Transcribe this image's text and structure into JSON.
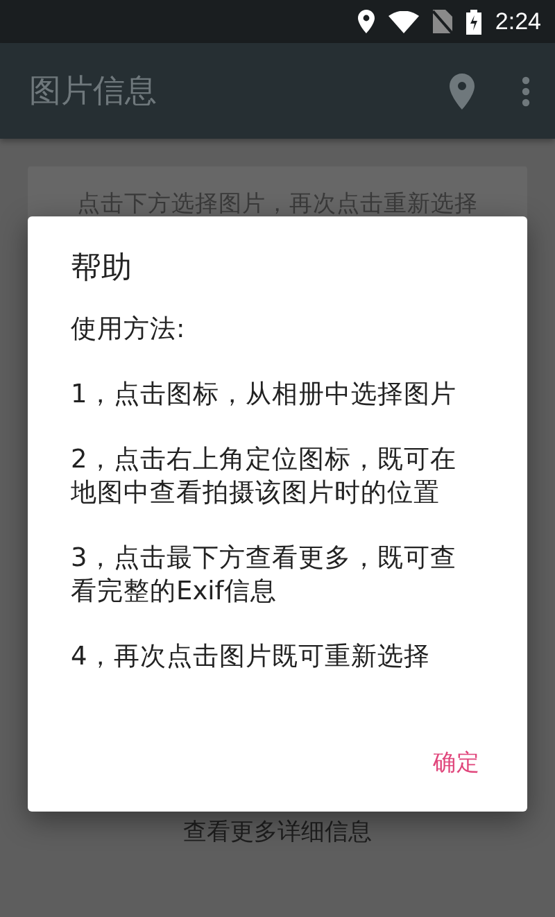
{
  "status_bar": {
    "time": "2:24"
  },
  "app_bar": {
    "title": "图片信息"
  },
  "card": {
    "hint": "点击下方选择图片，再次点击重新选择"
  },
  "footer": {
    "more": "查看更多详细信息"
  },
  "dialog": {
    "title": "帮助",
    "intro": "使用方法:",
    "steps": [
      {
        "lines": [
          "1，点击图标，从相册中选择图片"
        ]
      },
      {
        "lines": [
          "2，点击右上角定位图标，既可在",
          "地图中查看拍摄该图片时的位置"
        ]
      },
      {
        "lines": [
          "3，点击最下方查看更多，既可查",
          "看完整的Exif信息"
        ]
      },
      {
        "lines": [
          "4，再次点击图片既可重新选择"
        ]
      }
    ],
    "button": "确定"
  }
}
